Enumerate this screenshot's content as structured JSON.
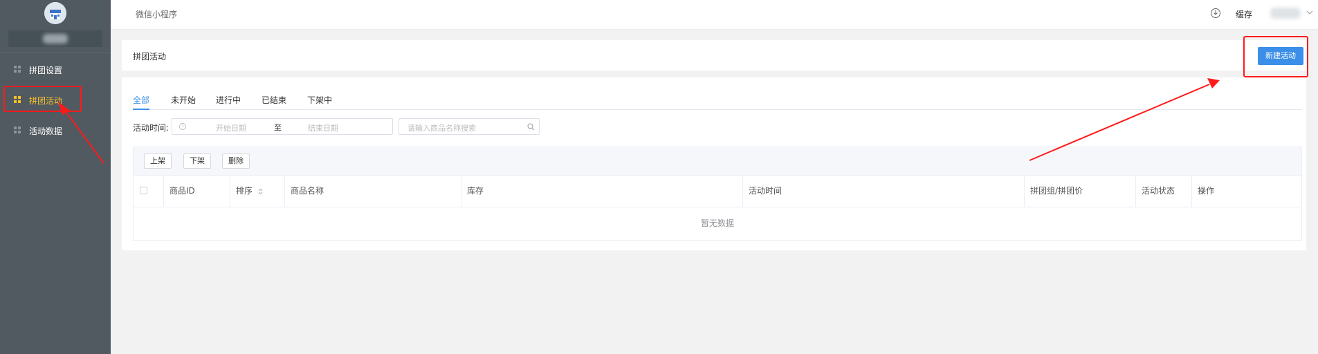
{
  "sidebar": {
    "items": [
      {
        "label": "拼团设置",
        "active": false
      },
      {
        "label": "拼团活动",
        "active": true
      },
      {
        "label": "活动数据",
        "active": false
      }
    ]
  },
  "topbar": {
    "title": "微信小程序",
    "cache_label": "缓存"
  },
  "card": {
    "title": "拼团活动",
    "new_button": "新建活动"
  },
  "tabs": [
    {
      "label": "全部",
      "active": true
    },
    {
      "label": "未开始",
      "active": false
    },
    {
      "label": "进行中",
      "active": false
    },
    {
      "label": "已结束",
      "active": false
    },
    {
      "label": "下架中",
      "active": false
    }
  ],
  "filter": {
    "label": "活动时间:",
    "start_placeholder": "开始日期",
    "separator": "至",
    "end_placeholder": "结束日期",
    "search_placeholder": "请输入商品名称搜索"
  },
  "toolbar": {
    "up_label": "上架",
    "down_label": "下架",
    "delete_label": "删除"
  },
  "table": {
    "columns": [
      "商品ID",
      "排序",
      "商品名称",
      "库存",
      "活动时间",
      "拼团组/拼团价",
      "活动状态",
      "操作"
    ],
    "empty_text": "暂无数据"
  },
  "colors": {
    "sidebar_bg": "#525a61",
    "active_menu": "#f6c12a",
    "primary": "#3b8fe8",
    "annotation_red": "#ff1a1a"
  },
  "icons": [
    "shop-logo-icon",
    "grid-icon",
    "download-circle-icon",
    "chevron-down-icon",
    "clock-icon",
    "search-icon",
    "sort-icon",
    "checkbox-icon",
    "arrow-annotation"
  ]
}
